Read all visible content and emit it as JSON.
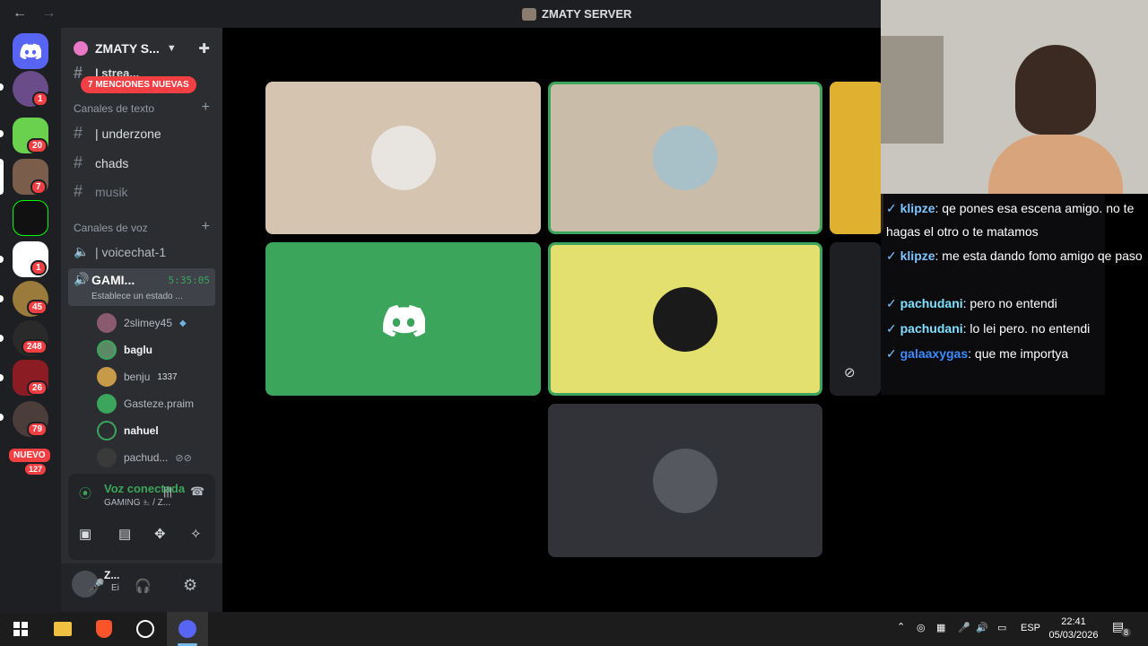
{
  "window": {
    "title": "ZMATY SERVER",
    "back_glyph": "←",
    "forward_glyph": "→"
  },
  "guilds": {
    "badges": [
      "1",
      "20",
      "7",
      "1",
      "45",
      "248",
      "26",
      "79",
      "127"
    ],
    "nuevo_label": "NUEVO"
  },
  "server": {
    "name": "ZMATY S...",
    "mentions_banner": "7 MENCIONES NUEVAS",
    "partial_channel": "| strea...",
    "text_category": "Canales de texto",
    "text_channels": [
      "| underzone",
      "chads",
      "musik"
    ],
    "voice_category": "Canales de voz",
    "voice_channels": [
      {
        "name": "| voicechat-1"
      },
      {
        "name": "GAMI...",
        "timer": "5:35:05",
        "status": "Establece un estado ..."
      }
    ],
    "members": [
      {
        "name": "2slimey45"
      },
      {
        "name": "baglu"
      },
      {
        "name": "benju",
        "extra": "1337"
      },
      {
        "name": "Gasteze.praim"
      },
      {
        "name": "nahuel"
      },
      {
        "name": "pachud..."
      }
    ]
  },
  "voice_panel": {
    "status": "Voz conectada",
    "channel": "GAMING ⎁ / Z..."
  },
  "user": {
    "name": "Z...",
    "status": "Ei"
  },
  "chat": [
    {
      "user": "klipze",
      "message": ": qe pones esa escena amigo. no te hagas el otro o te matamos"
    },
    {
      "user": "klipze",
      "message": ": me esta dando fomo amigo qe paso"
    },
    {
      "user": "pachudani",
      "message": ": pero no entendi"
    },
    {
      "user": "pachudani",
      "message": ": lo lei pero. no entendi"
    },
    {
      "user": "galaaxygas",
      "message": ": que me importya"
    }
  ],
  "taskbar": {
    "language": "ESP",
    "time": "22:41",
    "date": "05/03/2026",
    "notifications": "8"
  },
  "colors": {
    "green": "#3ba55c",
    "discord_blurple": "#5865f2",
    "red": "#f23f43"
  }
}
